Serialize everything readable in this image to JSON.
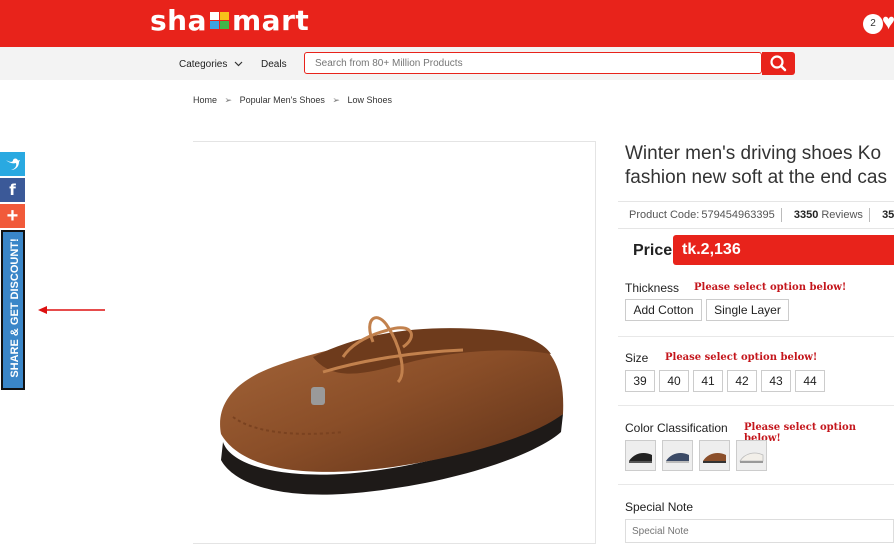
{
  "header": {
    "logo_text": "shapmart",
    "cart_count": "2",
    "brand_color": "#e8231b"
  },
  "nav": {
    "categories_label": "Categories",
    "deals_label": "Deals",
    "search_placeholder": "Search from 80+ Million Products"
  },
  "breadcrumb": [
    "Home",
    "Popular Men's Shoes",
    "Low Shoes"
  ],
  "sidebar": {
    "share_text": "SHARE & GET DISCOUNT!",
    "icons": [
      "twitter-icon",
      "facebook-icon",
      "plus-icon"
    ]
  },
  "product": {
    "title_line1": "Winter men's driving shoes Ko",
    "title_line2": "fashion new soft at the end cas",
    "code_label": "Product Code:",
    "code_value": "579454963395",
    "reviews_count": "3350",
    "reviews_label": "Reviews",
    "extra_count": "35",
    "price_label": "Price",
    "price_value": "tk.2,136"
  },
  "options": {
    "thickness_label": "Thickness",
    "thickness_warning": "Please select option below!",
    "thickness_values": [
      "Add Cotton",
      "Single Layer"
    ],
    "size_label": "Size",
    "size_warning": "Please select option below!",
    "size_values": [
      "39",
      "40",
      "41",
      "42",
      "43",
      "44"
    ],
    "color_label": "Color Classification",
    "color_warning": "Please select option below!",
    "note_label": "Special Note",
    "note_placeholder": "Special Note"
  }
}
